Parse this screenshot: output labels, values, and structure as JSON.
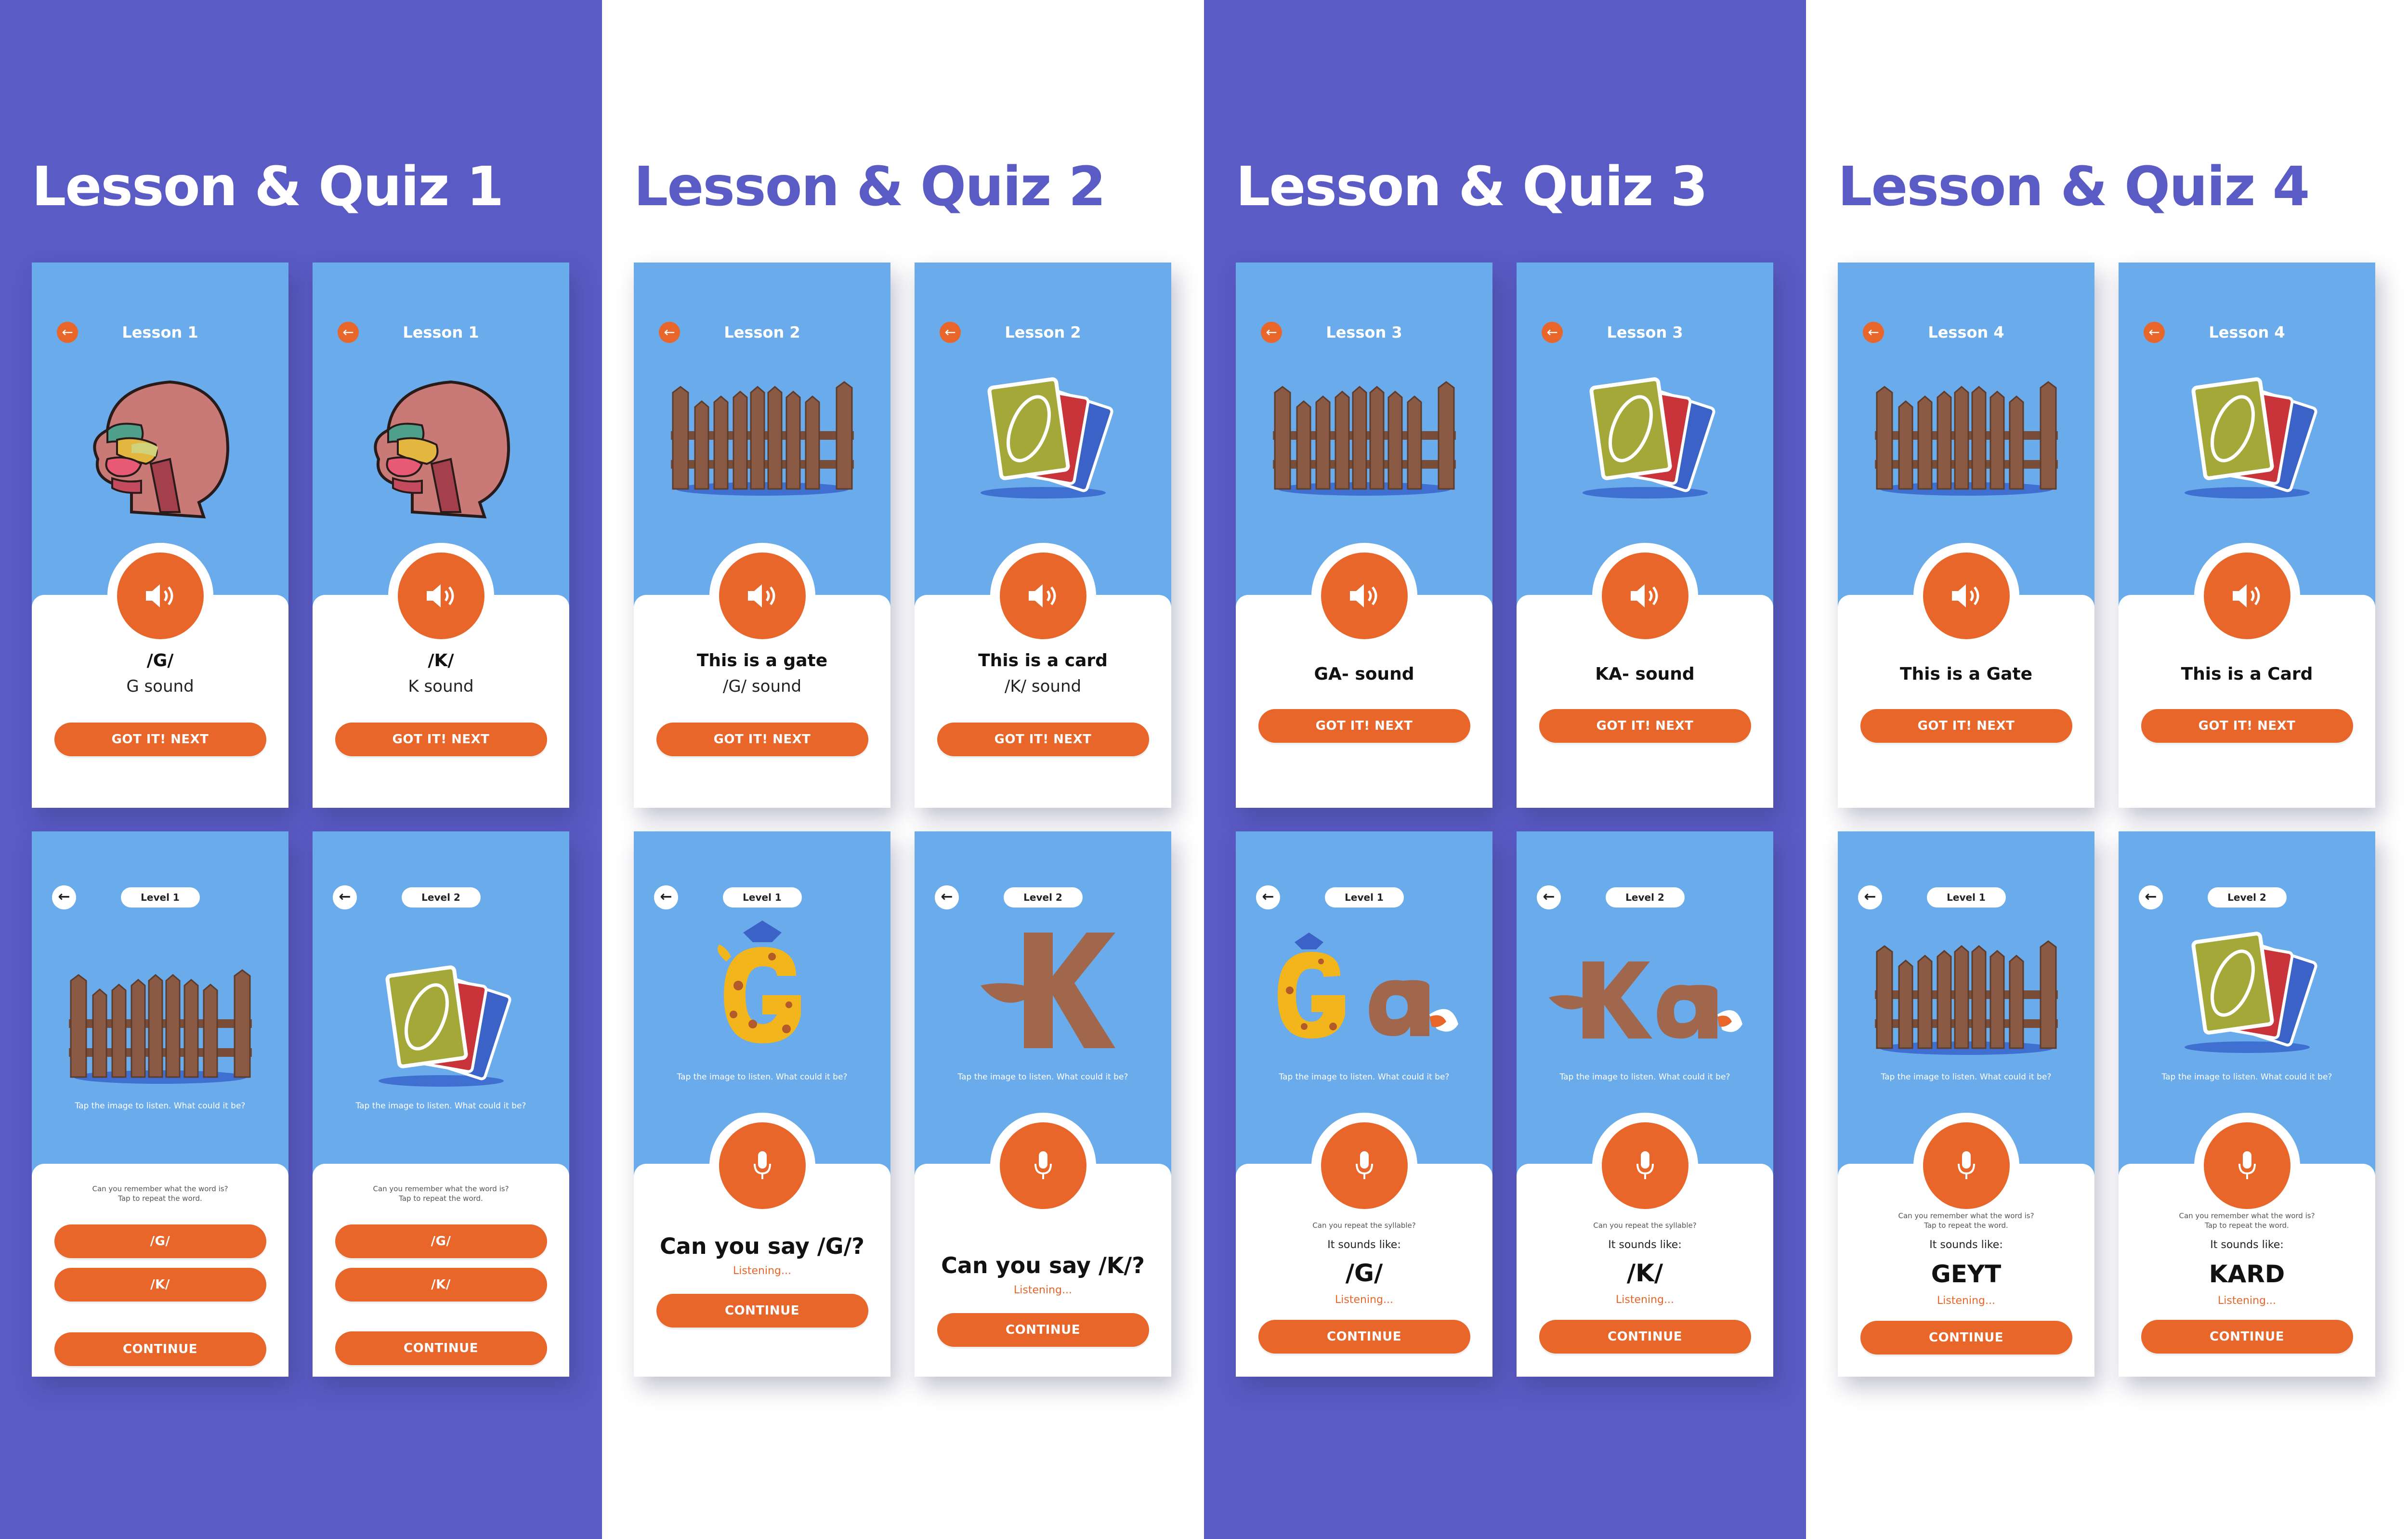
{
  "colors": {
    "purple": "#5b5bc5",
    "white": "#ffffff",
    "screen_blue": "#6aabeb",
    "accent_orange": "#e8662a",
    "fence_brown": "#8a5a44"
  },
  "sections": [
    {
      "title": "Lesson & Quiz 1",
      "theme": "purple"
    },
    {
      "title": "Lesson & Quiz 2",
      "theme": "white"
    },
    {
      "title": "Lesson & Quiz 3",
      "theme": "purple"
    },
    {
      "title": "Lesson & Quiz 4",
      "theme": "white"
    }
  ],
  "lessons": [
    {
      "header": "Lesson 1",
      "image": "head-anatomy",
      "line1": "/G/",
      "line2": "G sound",
      "button": "GOT IT! NEXT"
    },
    {
      "header": "Lesson 1",
      "image": "head-anatomy",
      "line1": "/K/",
      "line2": "K sound",
      "button": "GOT IT! NEXT"
    },
    {
      "header": "Lesson 2",
      "image": "gate",
      "line1": "This is a gate",
      "line2": "/G/ sound",
      "button": "GOT IT! NEXT"
    },
    {
      "header": "Lesson 2",
      "image": "card",
      "line1": "This is a card",
      "line2": "/K/ sound",
      "button": "GOT IT! NEXT"
    },
    {
      "header": "Lesson 3",
      "image": "gate",
      "line1": "GA- sound",
      "line2": "",
      "button": "GOT IT! NEXT"
    },
    {
      "header": "Lesson 3",
      "image": "card",
      "line1": "KA- sound",
      "line2": "",
      "button": "GOT IT! NEXT"
    },
    {
      "header": "Lesson 4",
      "image": "gate",
      "line1": "This is a Gate",
      "line2": "",
      "button": "GOT IT! NEXT"
    },
    {
      "header": "Lesson 4",
      "image": "card",
      "line1": "This is a Card",
      "line2": "",
      "button": "GOT IT! NEXT"
    }
  ],
  "quizzes": [
    {
      "level": "Level 1",
      "image": "gate",
      "hint": "Tap the image to listen. What could it be?",
      "prompt_line1": "Can you remember what the word is?",
      "prompt_line2": "Tap to repeat the word.",
      "options": [
        "/G/",
        "/K/"
      ],
      "button": "CONTINUE"
    },
    {
      "level": "Level 2",
      "image": "card",
      "hint": "Tap the image to listen. What could it be?",
      "prompt_line1": "Can you remember what the word is?",
      "prompt_line2": "Tap to repeat the word.",
      "options": [
        "/G/",
        "/K/"
      ],
      "button": "CONTINUE"
    },
    {
      "level": "Level 1",
      "image": "letter-g",
      "hint": "Tap the image to listen. What could it be?",
      "say": "Can you say /G/?",
      "listening": "Listening...",
      "button": "CONTINUE"
    },
    {
      "level": "Level 2",
      "image": "letter-k",
      "hint": "Tap the image to listen. What could it be?",
      "say": "Can you say /K/?",
      "listening": "Listening...",
      "button": "CONTINUE"
    },
    {
      "level": "Level 1",
      "image": "letters-ga",
      "hint": "Tap the image to listen. What could it be?",
      "prompt": "Can you repeat the syllable?",
      "sounds": "It sounds like:",
      "answer": "/G/",
      "listening": "Listening...",
      "button": "CONTINUE"
    },
    {
      "level": "Level 2",
      "image": "letters-ka",
      "hint": "Tap the image to listen. What could it be?",
      "prompt": "Can you repeat the syllable?",
      "sounds": "It sounds like:",
      "answer": "/K/",
      "listening": "Listening...",
      "button": "CONTINUE"
    },
    {
      "level": "Level 1",
      "image": "gate",
      "hint": "Tap the image to listen. What could it be?",
      "prompt_line1": "Can you remember what the word is?",
      "prompt_line2": "Tap to repeat the word.",
      "sounds": "It sounds like:",
      "answer": "GEYT",
      "listening": "Listening...",
      "button": "CONTINUE"
    },
    {
      "level": "Level 2",
      "image": "card",
      "hint": "Tap the image to listen. What could it be?",
      "prompt_line1": "Can you remember what the word is?",
      "prompt_line2": "Tap to repeat the word.",
      "sounds": "It sounds like:",
      "answer": "KARD",
      "listening": "Listening...",
      "button": "CONTINUE"
    }
  ]
}
